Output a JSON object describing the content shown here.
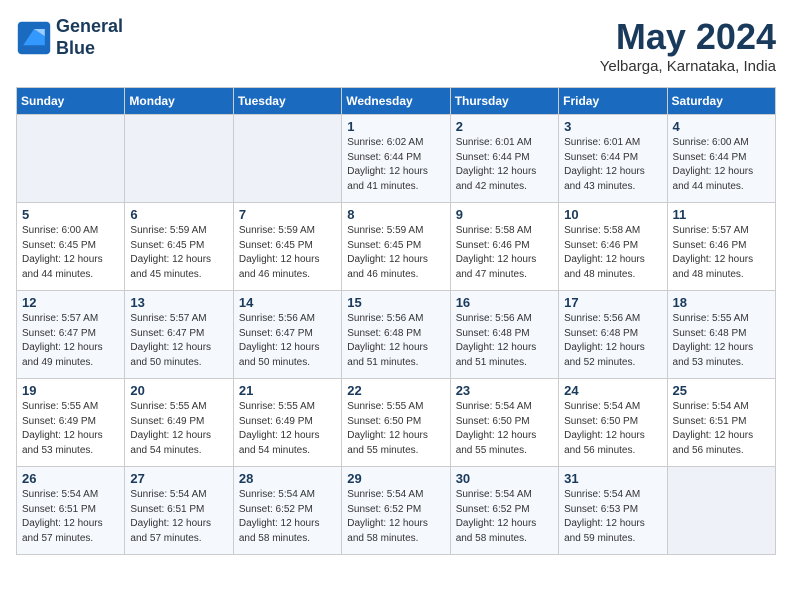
{
  "logo": {
    "line1": "General",
    "line2": "Blue"
  },
  "title": {
    "month_year": "May 2024",
    "location": "Yelbarga, Karnataka, India"
  },
  "weekdays": [
    "Sunday",
    "Monday",
    "Tuesday",
    "Wednesday",
    "Thursday",
    "Friday",
    "Saturday"
  ],
  "weeks": [
    [
      {
        "day": "",
        "info": ""
      },
      {
        "day": "",
        "info": ""
      },
      {
        "day": "",
        "info": ""
      },
      {
        "day": "1",
        "info": "Sunrise: 6:02 AM\nSunset: 6:44 PM\nDaylight: 12 hours\nand 41 minutes."
      },
      {
        "day": "2",
        "info": "Sunrise: 6:01 AM\nSunset: 6:44 PM\nDaylight: 12 hours\nand 42 minutes."
      },
      {
        "day": "3",
        "info": "Sunrise: 6:01 AM\nSunset: 6:44 PM\nDaylight: 12 hours\nand 43 minutes."
      },
      {
        "day": "4",
        "info": "Sunrise: 6:00 AM\nSunset: 6:44 PM\nDaylight: 12 hours\nand 44 minutes."
      }
    ],
    [
      {
        "day": "5",
        "info": "Sunrise: 6:00 AM\nSunset: 6:45 PM\nDaylight: 12 hours\nand 44 minutes."
      },
      {
        "day": "6",
        "info": "Sunrise: 5:59 AM\nSunset: 6:45 PM\nDaylight: 12 hours\nand 45 minutes."
      },
      {
        "day": "7",
        "info": "Sunrise: 5:59 AM\nSunset: 6:45 PM\nDaylight: 12 hours\nand 46 minutes."
      },
      {
        "day": "8",
        "info": "Sunrise: 5:59 AM\nSunset: 6:45 PM\nDaylight: 12 hours\nand 46 minutes."
      },
      {
        "day": "9",
        "info": "Sunrise: 5:58 AM\nSunset: 6:46 PM\nDaylight: 12 hours\nand 47 minutes."
      },
      {
        "day": "10",
        "info": "Sunrise: 5:58 AM\nSunset: 6:46 PM\nDaylight: 12 hours\nand 48 minutes."
      },
      {
        "day": "11",
        "info": "Sunrise: 5:57 AM\nSunset: 6:46 PM\nDaylight: 12 hours\nand 48 minutes."
      }
    ],
    [
      {
        "day": "12",
        "info": "Sunrise: 5:57 AM\nSunset: 6:47 PM\nDaylight: 12 hours\nand 49 minutes."
      },
      {
        "day": "13",
        "info": "Sunrise: 5:57 AM\nSunset: 6:47 PM\nDaylight: 12 hours\nand 50 minutes."
      },
      {
        "day": "14",
        "info": "Sunrise: 5:56 AM\nSunset: 6:47 PM\nDaylight: 12 hours\nand 50 minutes."
      },
      {
        "day": "15",
        "info": "Sunrise: 5:56 AM\nSunset: 6:48 PM\nDaylight: 12 hours\nand 51 minutes."
      },
      {
        "day": "16",
        "info": "Sunrise: 5:56 AM\nSunset: 6:48 PM\nDaylight: 12 hours\nand 51 minutes."
      },
      {
        "day": "17",
        "info": "Sunrise: 5:56 AM\nSunset: 6:48 PM\nDaylight: 12 hours\nand 52 minutes."
      },
      {
        "day": "18",
        "info": "Sunrise: 5:55 AM\nSunset: 6:48 PM\nDaylight: 12 hours\nand 53 minutes."
      }
    ],
    [
      {
        "day": "19",
        "info": "Sunrise: 5:55 AM\nSunset: 6:49 PM\nDaylight: 12 hours\nand 53 minutes."
      },
      {
        "day": "20",
        "info": "Sunrise: 5:55 AM\nSunset: 6:49 PM\nDaylight: 12 hours\nand 54 minutes."
      },
      {
        "day": "21",
        "info": "Sunrise: 5:55 AM\nSunset: 6:49 PM\nDaylight: 12 hours\nand 54 minutes."
      },
      {
        "day": "22",
        "info": "Sunrise: 5:55 AM\nSunset: 6:50 PM\nDaylight: 12 hours\nand 55 minutes."
      },
      {
        "day": "23",
        "info": "Sunrise: 5:54 AM\nSunset: 6:50 PM\nDaylight: 12 hours\nand 55 minutes."
      },
      {
        "day": "24",
        "info": "Sunrise: 5:54 AM\nSunset: 6:50 PM\nDaylight: 12 hours\nand 56 minutes."
      },
      {
        "day": "25",
        "info": "Sunrise: 5:54 AM\nSunset: 6:51 PM\nDaylight: 12 hours\nand 56 minutes."
      }
    ],
    [
      {
        "day": "26",
        "info": "Sunrise: 5:54 AM\nSunset: 6:51 PM\nDaylight: 12 hours\nand 57 minutes."
      },
      {
        "day": "27",
        "info": "Sunrise: 5:54 AM\nSunset: 6:51 PM\nDaylight: 12 hours\nand 57 minutes."
      },
      {
        "day": "28",
        "info": "Sunrise: 5:54 AM\nSunset: 6:52 PM\nDaylight: 12 hours\nand 58 minutes."
      },
      {
        "day": "29",
        "info": "Sunrise: 5:54 AM\nSunset: 6:52 PM\nDaylight: 12 hours\nand 58 minutes."
      },
      {
        "day": "30",
        "info": "Sunrise: 5:54 AM\nSunset: 6:52 PM\nDaylight: 12 hours\nand 58 minutes."
      },
      {
        "day": "31",
        "info": "Sunrise: 5:54 AM\nSunset: 6:53 PM\nDaylight: 12 hours\nand 59 minutes."
      },
      {
        "day": "",
        "info": ""
      }
    ]
  ]
}
